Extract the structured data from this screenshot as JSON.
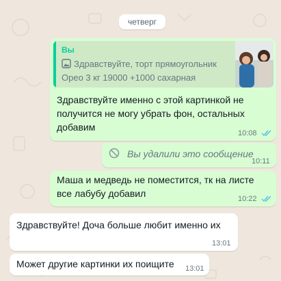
{
  "date_separator": "четверг",
  "messages": [
    {
      "direction": "outgoing",
      "quote": {
        "author": "Вы",
        "icon": "photo-icon",
        "line1": "Здравствуйте, торт прямоугольник",
        "line2": "Орео 3 кг 19000 +1000 сахарная"
      },
      "text_lines": [
        "Здравствуйте именно с этой картинкой не",
        "получится не могу убрать фон, остальных",
        "добавим"
      ],
      "time": "10:08",
      "status": "read"
    },
    {
      "direction": "outgoing",
      "deleted": true,
      "icon": "blocked-icon",
      "text": "Вы удалили это сообщение",
      "time": "10:11"
    },
    {
      "direction": "outgoing",
      "text_lines": [
        "Маша и медведь не поместится, тк на листе",
        "все лабубу добавил"
      ],
      "time": "10:22",
      "status": "read"
    },
    {
      "direction": "incoming",
      "text": "Здравствуйте! Доча больше любит именно их",
      "time": "13:01"
    },
    {
      "direction": "incoming",
      "text": "Может другие картинки их поищите",
      "time": "13:01"
    }
  ],
  "colors": {
    "chat_background": "#efe7dd",
    "outgoing_bubble": "#d9fdd3",
    "incoming_bubble": "#ffffff",
    "quote_accent": "#06cf9c",
    "read_ticks": "#53bdeb"
  }
}
